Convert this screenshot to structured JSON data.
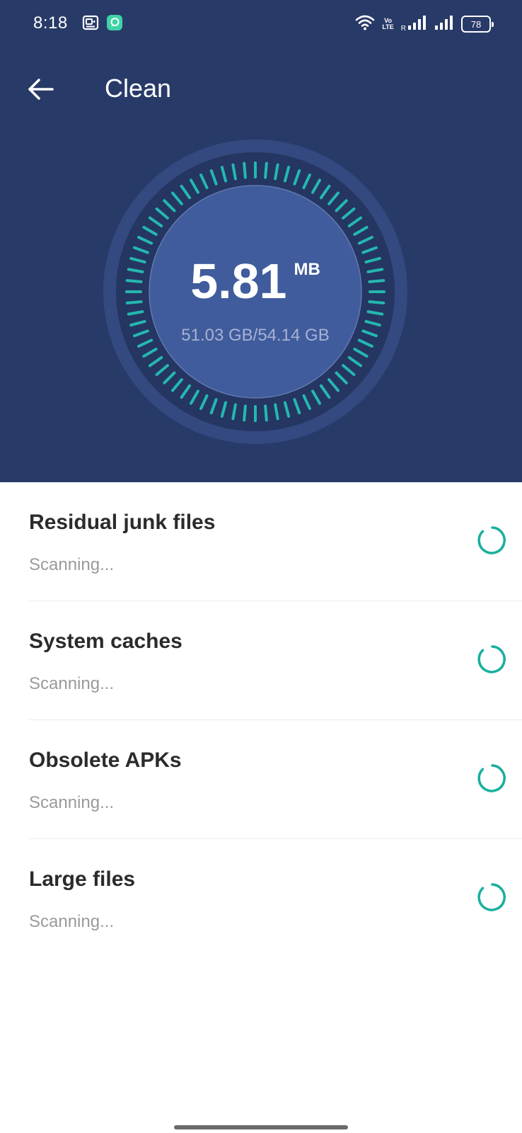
{
  "status_bar": {
    "time": "8:18",
    "volte_top": "Vo",
    "volte_bottom": "LTE",
    "roaming": "R",
    "battery": "78"
  },
  "header": {
    "title": "Clean",
    "background_color": "#283a68"
  },
  "gauge": {
    "value": "5.81",
    "unit": "MB",
    "storage": "51.03 GB/54.14 GB",
    "tick_color": "#25b7b0"
  },
  "scan_items": [
    {
      "title": "Residual junk files",
      "status": "Scanning..."
    },
    {
      "title": "System caches",
      "status": "Scanning..."
    },
    {
      "title": "Obsolete APKs",
      "status": "Scanning..."
    },
    {
      "title": "Large files",
      "status": "Scanning..."
    }
  ],
  "icons": {
    "back": "arrow-left-icon",
    "spinner": "loading-spinner-icon"
  }
}
